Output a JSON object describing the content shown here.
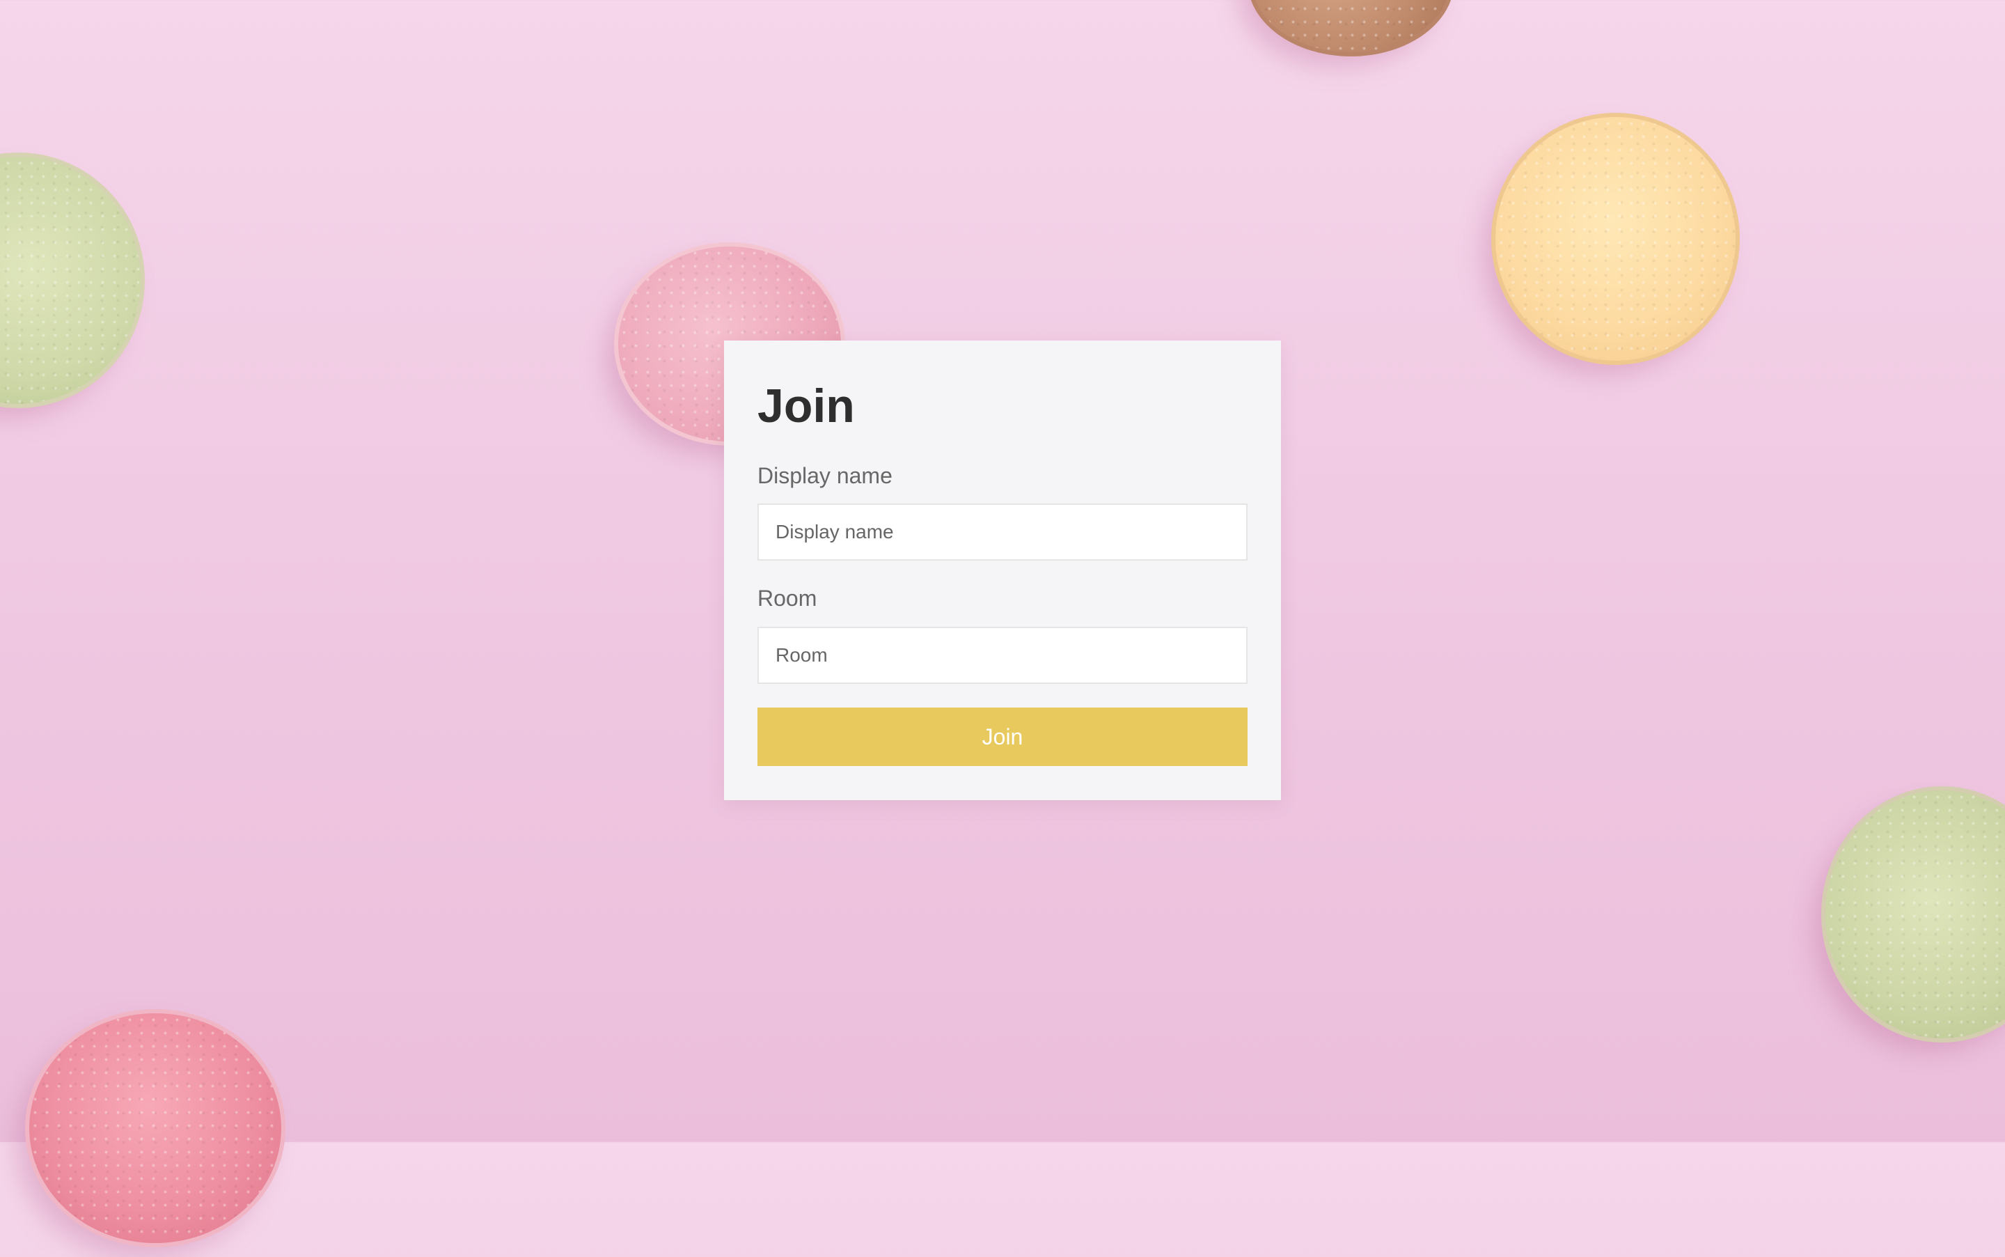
{
  "form": {
    "title": "Join",
    "display_name": {
      "label": "Display name",
      "placeholder": "Display name",
      "value": ""
    },
    "room": {
      "label": "Room",
      "placeholder": "Room",
      "value": ""
    },
    "submit_label": "Join"
  },
  "colors": {
    "background": "#f3d0e7",
    "card": "#f5f5f7",
    "button": "#e8c95e",
    "title_text": "#2e2e2e",
    "label_text": "#676767"
  }
}
